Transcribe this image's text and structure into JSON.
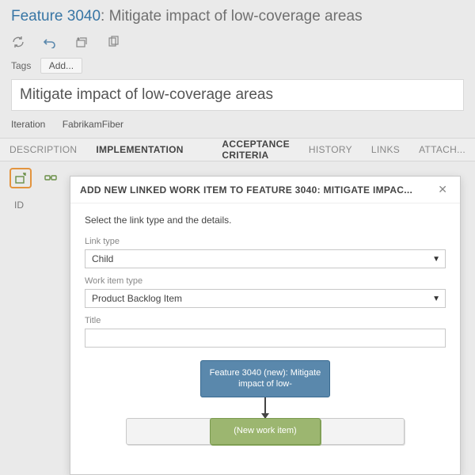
{
  "header": {
    "feature_id": "Feature 3040",
    "separator": ": ",
    "feature_name": "Mitigate impact of low-coverage areas"
  },
  "tags": {
    "label": "Tags",
    "add_button": "Add..."
  },
  "title_field": "Mitigate impact of low-coverage areas",
  "iteration": {
    "label": "Iteration",
    "value": "FabrikamFiber"
  },
  "tabs": {
    "description": "DESCRIPTION",
    "implementation": "IMPLEMENTATION",
    "acceptance": "ACCEPTANCE CRITERIA",
    "history": "HISTORY",
    "links": "LINKS",
    "attach": "ATTACH..."
  },
  "grid": {
    "id_header": "ID"
  },
  "modal": {
    "title": "ADD NEW LINKED WORK ITEM TO FEATURE 3040: MITIGATE IMPAC...",
    "intro": "Select the link type and the details.",
    "link_type_label": "Link type",
    "link_type_value": "Child",
    "work_item_type_label": "Work item type",
    "work_item_type_value": "Product Backlog Item",
    "title_label": "Title",
    "title_value": "",
    "diagram": {
      "parent_text": "Feature 3040 (new): Mitigate impact of low-",
      "new_item_text": "(New work item)"
    }
  }
}
